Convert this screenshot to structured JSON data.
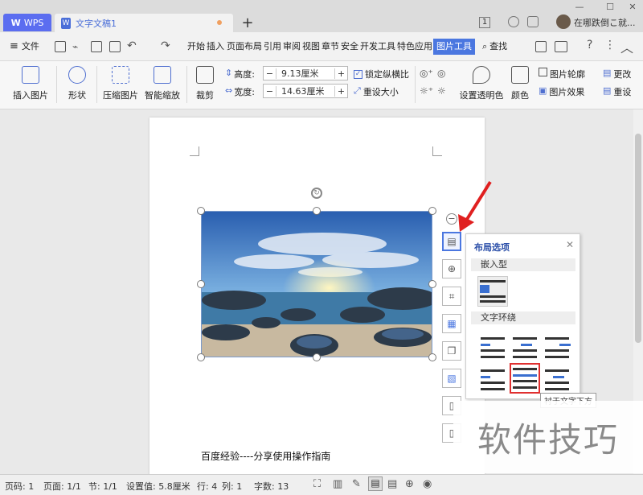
{
  "titlebar": {
    "wps_tab": "WPS",
    "doc_tab": "文字文稿1",
    "badge_count": "1",
    "user_text": "在哪跌倒こ就..."
  },
  "menubar": {
    "file": "文件",
    "items": [
      "开始",
      "插入",
      "页面布局",
      "引用",
      "审阅",
      "视图",
      "章节",
      "安全",
      "开发工具",
      "特色应用"
    ],
    "active": "图片工具",
    "search": "查找"
  },
  "ribbon": {
    "insert_image": "插入图片",
    "shape": "形状",
    "compress": "压缩图片",
    "smart_scale": "智能缩放",
    "crop": "裁剪",
    "height_label": "高度:",
    "height_value": "9.13厘米",
    "width_label": "宽度:",
    "width_value": "14.63厘米",
    "lock_ratio": "锁定纵横比",
    "reset_size": "重设大小",
    "set_transparent": "设置透明色",
    "color": "颜色",
    "outline": "图片轮廓",
    "effect": "图片效果",
    "change": "更改",
    "reset": "重设"
  },
  "layout_popup": {
    "title": "布局选项",
    "inline_section": "嵌入型",
    "wrap_section": "文字环绕",
    "tooltip": "衬于文字下方"
  },
  "document": {
    "body_text": "百度经验----分享使用操作指南"
  },
  "statusbar": {
    "page_num": "页码: 1",
    "page": "页面: 1/1",
    "section": "节: 1/1",
    "setting": "设置值: 5.8厘米",
    "row": "行: 4",
    "col": "列: 1",
    "word_count": "字数: 13"
  },
  "watermark": "软件技巧",
  "colors": {
    "accent": "#4b77e0",
    "highlight_border": "#e03030",
    "arrow": "#e02020"
  }
}
